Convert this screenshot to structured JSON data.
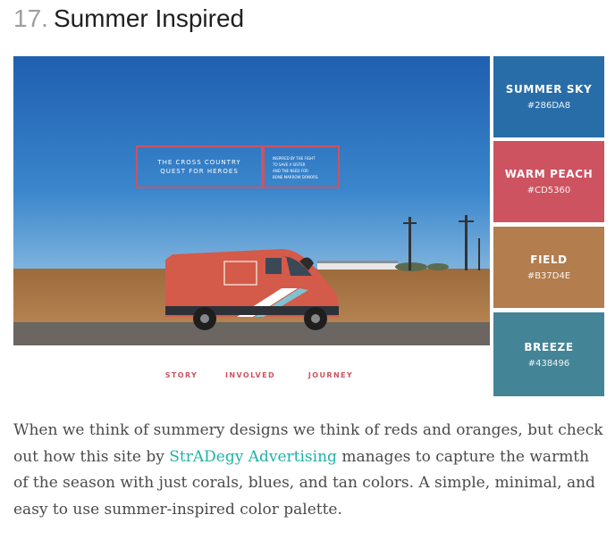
{
  "heading": {
    "number": "17.",
    "title": "Summer Inspired"
  },
  "hero": {
    "sign_left_line1": "THE CROSS COUNTRY",
    "sign_left_line2": "QUEST FOR HEROES",
    "sign_right_line1": "INSPIRED BY THE FIGHT",
    "sign_right_line2": "TO SAVE A SISTER",
    "sign_right_line3": "AND THE NEED FOR",
    "sign_right_line4": "BONE MARROW DONORS.",
    "nav": [
      "STORY",
      "INVOLVED",
      "JOURNEY"
    ]
  },
  "palette": [
    {
      "name": "SUMMER SKY",
      "hex": "#286DA8"
    },
    {
      "name": "WARM PEACH",
      "hex": "#CD5360"
    },
    {
      "name": "FIELD",
      "hex": "#B37D4E"
    },
    {
      "name": "BREEZE",
      "hex": "#438496"
    }
  ],
  "description": {
    "before": "When we think of summery designs we think of reds and oranges, but check out how this site by ",
    "link": "StrADegy Advertising",
    "after": " manages to capture the warmth of the season with just corals, blues, and tan colors. A simple, minimal, and easy to use summer-inspired color palette."
  }
}
